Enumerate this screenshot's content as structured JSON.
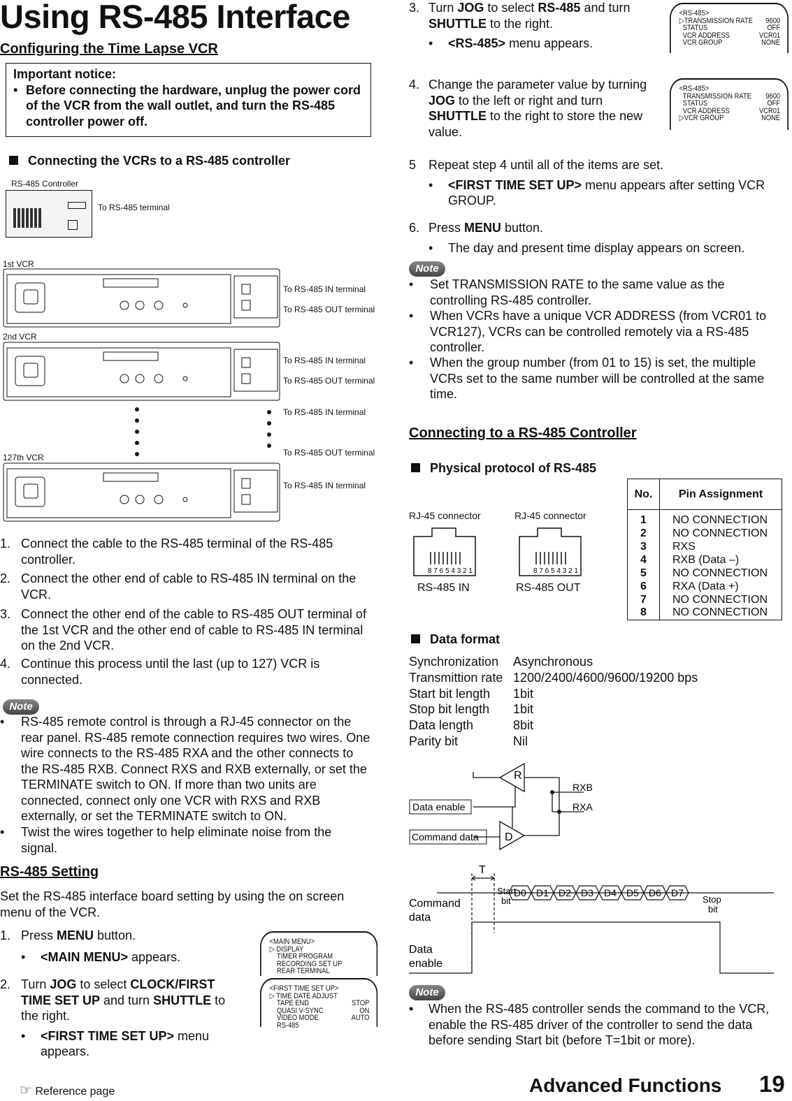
{
  "title": "Using RS-485 Interface",
  "section1": "Configuring the Time Lapse VCR",
  "notice": {
    "title": "Important notice:",
    "text": "Before connecting the hardware, unplug the power cord of the VCR from the wall outlet, and turn the RS-485 controller power off."
  },
  "connect_heading": "Connecting the VCRs to a RS-485 controller",
  "diagram": {
    "controller": "RS-485 Controller",
    "to_terminal": "To RS-485 terminal",
    "vcr1": "1st VCR",
    "vcr2": "2nd VCR",
    "vcr127": "127th VCR",
    "in": "To RS-485 IN terminal",
    "out": "To RS-485 OUT terminal"
  },
  "steps_connect": [
    "Connect the cable to the RS-485 terminal of the RS-485 controller.",
    "Connect the other end of cable to RS-485 IN terminal on the VCR.",
    "Connect the other end of the cable to RS-485 OUT terminal of the 1st VCR and the other end of cable to RS-485 IN terminal on the 2nd VCR.",
    "Continue this process until the last (up to 127) VCR is connected."
  ],
  "note_label": "Note",
  "notes_left": [
    "RS-485 remote control is through a RJ-45 connector on the rear panel.  RS-485 remote connection requires two wires. One wire connects to the RS-485 RXA and the other connects to the RS-485 RXB.  Connect RXS and RXB externally, or set the TERMINATE switch to ON.  If more than two units are connected, connect only one VCR with RXS and RXB externally, or set the TERMINATE switch to ON.",
    "Twist the wires together to help eliminate noise from the signal."
  ],
  "setting": {
    "heading": "RS-485 Setting",
    "intro": "Set the RS-485 interface board setting by using the on screen menu of the VCR."
  },
  "osd_main": {
    "title": "<MAIN MENU>",
    "items": [
      "DISPLAY",
      "TIMER PROGRAM",
      "RECORDING SET UP",
      "REAR TERMINAL"
    ]
  },
  "osd_first": {
    "title": "<FIRST TIME SET UP>",
    "items": [
      [
        "TIME DATE ADJUST",
        ""
      ],
      [
        "TAPE END",
        "STOP"
      ],
      [
        "QUASI V-SYNC",
        "ON"
      ],
      [
        "VIDEO MODE",
        "AUTO"
      ],
      [
        "RS-485",
        ""
      ]
    ]
  },
  "osd_rs": {
    "title": "<RS-485>",
    "items": [
      [
        "TRANSMISSION RATE",
        "9600"
      ],
      [
        "STATUS",
        "OFF"
      ],
      [
        "VCR ADDRESS",
        "VCR01"
      ],
      [
        "VCR GROUP",
        "NONE"
      ]
    ]
  },
  "step_nums": [
    "1.",
    "2.",
    "3.",
    "4.",
    "5",
    "6."
  ],
  "bullet": "•",
  "footer": {
    "ref": "Reference page",
    "section": "Advanced Functions",
    "page": "19"
  },
  "right_notes": [
    "Set TRANSMISSION RATE to the same value as the controlling RS-485 controller.",
    "When VCRs have a unique VCR ADDRESS (from VCR01 to VCR127), VCRs can be controlled remotely via a RS-485 controller.",
    "When the group number (from 01 to 15) is set, the multiple VCRs set to the same number will be controlled at the same time."
  ],
  "connect2": "Connecting to a RS-485 Controller",
  "physical": "Physical protocol of RS-485",
  "rj45": {
    "label": "RJ-45 connector",
    "pins": "8 7 6 5 4 3 2 1",
    "in": "RS-485 IN",
    "out": "RS-485 OUT"
  },
  "pin_table": {
    "headers": [
      "No.",
      "Pin Assignment"
    ],
    "rows": [
      [
        "1",
        "NO CONNECTION"
      ],
      [
        "2",
        "NO CONNECTION"
      ],
      [
        "3",
        "RXS"
      ],
      [
        "4",
        "RXB (Data –)"
      ],
      [
        "5",
        "NO CONNECTION"
      ],
      [
        "6",
        "RXA (Data +)"
      ],
      [
        "7",
        "NO CONNECTION"
      ],
      [
        "8",
        "NO CONNECTION"
      ]
    ]
  },
  "data_format": {
    "heading": "Data format",
    "rows": [
      [
        "Synchronization",
        "Asynchronous"
      ],
      [
        "Transmittion rate",
        "1200/2400/4600/9600/19200 bps"
      ],
      [
        "Start bit length",
        "1bit"
      ],
      [
        "Stop bit length",
        "1bit"
      ],
      [
        "Data length",
        "8bit"
      ],
      [
        "Parity bit",
        "Nil"
      ]
    ]
  },
  "circuit": {
    "r": "R",
    "d": "D",
    "rxb": "RXB",
    "rxa": "RXA",
    "enable": "Data enable",
    "command": "Command data"
  },
  "timing": {
    "t": "T",
    "command": "Command data",
    "enable": "Data enable",
    "start": "Start bit",
    "stop": "Stop bit",
    "bits": [
      "D0",
      "D1",
      "D2",
      "D3",
      "D4",
      "D5",
      "D6",
      "D7"
    ]
  },
  "final_note": "When the RS-485 controller sends the command to the VCR, enable the RS-485 driver of the controller to send the data before sending Start bit (before T=1bit or more)."
}
